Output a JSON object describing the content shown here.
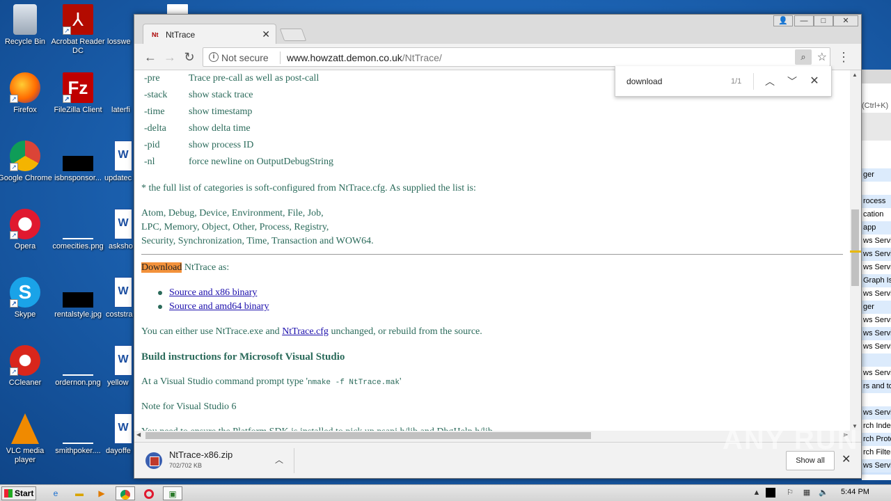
{
  "desktop": {
    "icons": [
      {
        "label": "Recycle Bin"
      },
      {
        "label": "Acrobat Reader DC"
      },
      {
        "label": "losswe"
      },
      {
        "label": "Firefox"
      },
      {
        "label": "FileZilla Client"
      },
      {
        "label": "laterfi"
      },
      {
        "label": "Google Chrome"
      },
      {
        "label": "isbnsponsor..."
      },
      {
        "label": "updatec"
      },
      {
        "label": "Opera"
      },
      {
        "label": "comecities.png"
      },
      {
        "label": "asksho"
      },
      {
        "label": "Skype"
      },
      {
        "label": "rentalstyle.jpg"
      },
      {
        "label": "coststra"
      },
      {
        "label": "CCleaner"
      },
      {
        "label": "ordernon.png"
      },
      {
        "label": "yellow"
      },
      {
        "label": "VLC media player"
      },
      {
        "label": "smithpoker...."
      },
      {
        "label": "dayoffe"
      }
    ]
  },
  "bgapp": {
    "hint": "(Ctrl+K)",
    "rows": [
      "ger",
      "",
      "rocess",
      "cation",
      "app",
      "ws Servi",
      "ws Servi",
      "ws Servi",
      "Graph Is",
      "ws Servi",
      "ger",
      "ws Servi",
      "ws Servi",
      "ws Servi",
      "",
      "ws Servi",
      "rs and to",
      "",
      "ws Servi",
      "rch Index",
      "rch Proto",
      "rch Filter",
      "ws Servi"
    ]
  },
  "browser": {
    "tab_title": "NtTrace",
    "window_buttons": {
      "user": "👤",
      "minimize": "—",
      "maximize": "□",
      "close": "✕"
    },
    "security_text": "Not secure",
    "url_host": "www.howzatt.demon.co.uk",
    "url_path": "/NtTrace/",
    "find": {
      "query": "download",
      "count": "1/1"
    },
    "download": {
      "filename": "NtTrace-x86.zip",
      "size": "702/702 KB",
      "show_all": "Show all"
    }
  },
  "page": {
    "options": [
      {
        "flag": "-pre",
        "desc": "Trace pre-call as well as post-call"
      },
      {
        "flag": "-stack",
        "desc": "show stack trace"
      },
      {
        "flag": "-time",
        "desc": "show timestamp"
      },
      {
        "flag": "-delta",
        "desc": "show delta time"
      },
      {
        "flag": "-pid",
        "desc": "show process ID"
      },
      {
        "flag": "-nl",
        "desc": "force newline on OutputDebugString"
      }
    ],
    "categories_note": "* the full list of categories is soft-configured from NtTrace.cfg. As supplied the list is:",
    "categories_lines": [
      "Atom, Debug, Device, Environment, File, Job,",
      "LPC, Memory, Object, Other, Process, Registry,",
      "Security, Synchronization, Time, Transaction and WOW64."
    ],
    "download_word": "Download",
    "download_rest": " NtTrace as:",
    "download_links": [
      "Source and x86 binary",
      "Source and amd64 binary"
    ],
    "use_pre": "You can either use NtTrace.exe and ",
    "use_link": "NtTrace.cfg",
    "use_post": " unchanged, or rebuild from the source.",
    "build_heading": "Build instructions for Microsoft Visual Studio",
    "vs_prompt_pre": "At a Visual Studio command prompt type '",
    "vs_prompt_cmd": "nmake -f NtTrace.mak",
    "vs_prompt_post": "'",
    "vs6_note": "Note for Visual Studio 6",
    "sdk_note": "You need to ensure the Platform SDK is installed to pick up psapi.h/lib and DbgHelp.h/lib"
  },
  "taskbar": {
    "start_label": "Start",
    "clock": "5:44 PM"
  },
  "watermark": "ANY RUN"
}
